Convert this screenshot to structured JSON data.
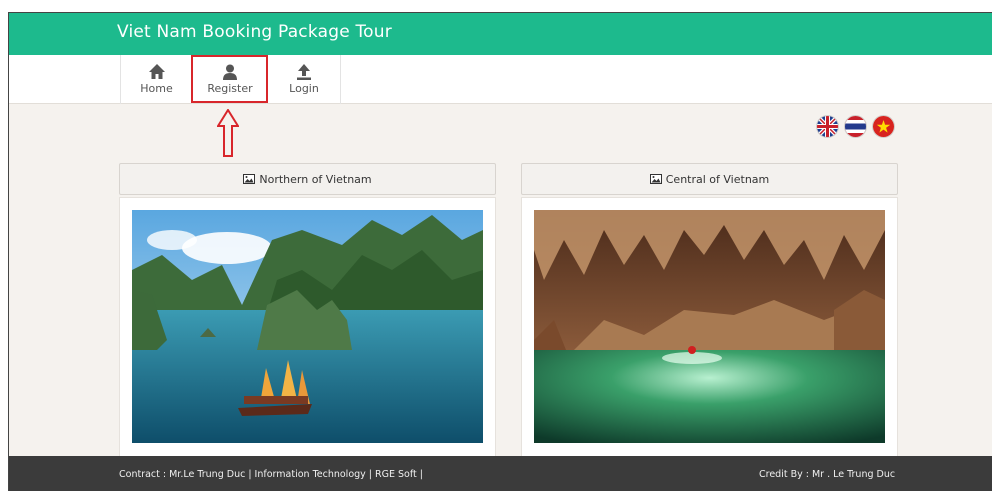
{
  "header": {
    "title": "Viet Nam Booking Package Tour"
  },
  "nav": {
    "items": [
      {
        "label": "Home",
        "icon": "home-icon"
      },
      {
        "label": "Register",
        "icon": "user-icon"
      },
      {
        "label": "Login",
        "icon": "upload-icon"
      }
    ],
    "highlighted": "Register"
  },
  "languages": [
    {
      "name": "English",
      "icon": "uk-flag-icon"
    },
    {
      "name": "Thai",
      "icon": "thai-flag-icon"
    },
    {
      "name": "Vietnamese",
      "icon": "vietnam-flag-icon"
    }
  ],
  "panels": [
    {
      "title": "Northern of Vietnam",
      "image": "ha-long-bay-photo"
    },
    {
      "title": "Central of Vietnam",
      "image": "cave-lake-photo"
    }
  ],
  "footer": {
    "left": "Contract : Mr.Le Trung Duc | Information Technology | RGE Soft |",
    "right": "Credit By : Mr . Le Trung Duc"
  },
  "colors": {
    "header": "#1dba8d",
    "footer": "#3b3b3b",
    "highlight": "#d8262b"
  }
}
